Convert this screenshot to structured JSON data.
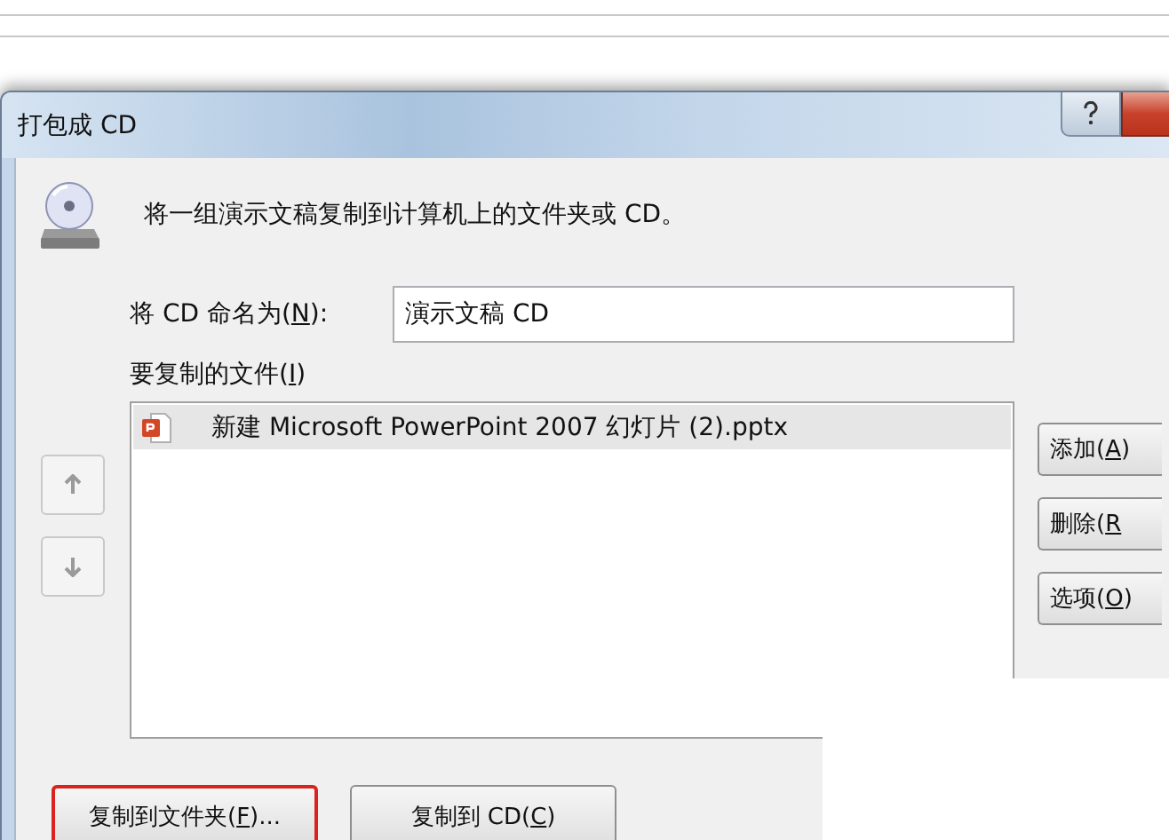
{
  "window": {
    "title": "打包成 CD"
  },
  "intro": "将一组演示文稿复制到计算机上的文件夹或 CD。",
  "name_field": {
    "label_before": "将 CD 命名为(",
    "access_key": "N",
    "label_after": "):",
    "value": "演示文稿 CD"
  },
  "files_label": {
    "label_before": "要复制的文件(",
    "access_key": "I",
    "label_after": ")"
  },
  "files": [
    {
      "name": "新建 Microsoft PowerPoint 2007 幻灯片 (2).pptx",
      "selected": true
    }
  ],
  "move_buttons": [
    {
      "kind": "up",
      "disabled": true
    },
    {
      "kind": "down",
      "disabled": true
    }
  ],
  "side_buttons": [
    {
      "label_before": "添加(",
      "access_key": "A",
      "label_after": ")"
    },
    {
      "label_before": "删除(",
      "access_key": "R"
    },
    {
      "label_before": "选项(",
      "access_key": "O",
      "label_after": ")"
    }
  ],
  "bottom_buttons": [
    {
      "label_before": "复制到文件夹(",
      "access_key": "F",
      "label_after": ")...",
      "highlighted": true
    },
    {
      "label_before": "复制到 CD(",
      "access_key": "C",
      "label_after": ")",
      "highlighted": false
    }
  ]
}
